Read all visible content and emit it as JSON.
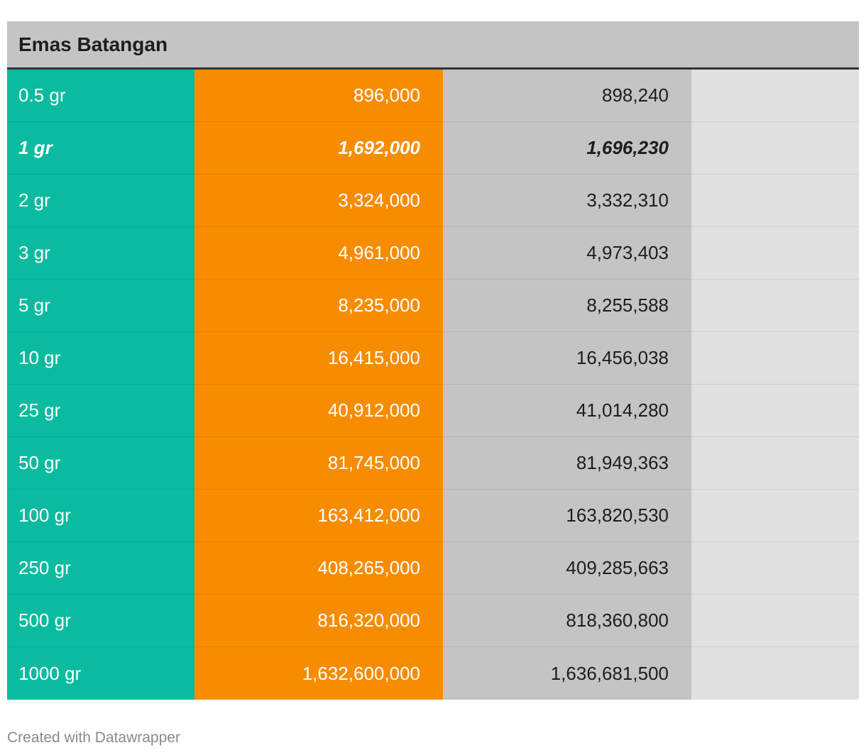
{
  "table": {
    "title": "Emas Batangan",
    "colors": {
      "weight_column": "#0abb9f",
      "sell_column": "#f78c00",
      "buy_column": "#c4c4c4",
      "empty_column": "#e0e0e0",
      "header_bg": "#c4c4c4"
    },
    "rows": [
      {
        "weight": "0.5 gr",
        "value_a": "896,000",
        "value_b": "898,240",
        "highlight": false
      },
      {
        "weight": "1 gr",
        "value_a": "1,692,000",
        "value_b": "1,696,230",
        "highlight": true
      },
      {
        "weight": "2 gr",
        "value_a": "3,324,000",
        "value_b": "3,332,310",
        "highlight": false
      },
      {
        "weight": "3 gr",
        "value_a": "4,961,000",
        "value_b": "4,973,403",
        "highlight": false
      },
      {
        "weight": "5 gr",
        "value_a": "8,235,000",
        "value_b": "8,255,588",
        "highlight": false
      },
      {
        "weight": "10 gr",
        "value_a": "16,415,000",
        "value_b": "16,456,038",
        "highlight": false
      },
      {
        "weight": "25 gr",
        "value_a": "40,912,000",
        "value_b": "41,014,280",
        "highlight": false
      },
      {
        "weight": "50 gr",
        "value_a": "81,745,000",
        "value_b": "81,949,363",
        "highlight": false
      },
      {
        "weight": "100 gr",
        "value_a": "163,412,000",
        "value_b": "163,820,530",
        "highlight": false
      },
      {
        "weight": "250 gr",
        "value_a": "408,265,000",
        "value_b": "409,285,663",
        "highlight": false
      },
      {
        "weight": "500 gr",
        "value_a": "816,320,000",
        "value_b": "818,360,800",
        "highlight": false
      },
      {
        "weight": "1000 gr",
        "value_a": "1,632,600,000",
        "value_b": "1,636,681,500",
        "highlight": false
      }
    ]
  },
  "footer": {
    "credit": "Created with Datawrapper"
  },
  "chart_data": {
    "type": "table",
    "title": "Emas Batangan",
    "columns": [
      "",
      "",
      ""
    ],
    "rows": [
      [
        "0.5 gr",
        896000,
        898240
      ],
      [
        "1 gr",
        1692000,
        1696230
      ],
      [
        "2 gr",
        3324000,
        3332310
      ],
      [
        "3 gr",
        4961000,
        4973403
      ],
      [
        "5 gr",
        8235000,
        8255588
      ],
      [
        "10 gr",
        16415000,
        16456038
      ],
      [
        "25 gr",
        40912000,
        41014280
      ],
      [
        "50 gr",
        81745000,
        81949363
      ],
      [
        "100 gr",
        163412000,
        163820530
      ],
      [
        "250 gr",
        408265000,
        409285663
      ],
      [
        "500 gr",
        816320000,
        818360800
      ],
      [
        "1000 gr",
        1632600000,
        1636681500
      ]
    ]
  }
}
